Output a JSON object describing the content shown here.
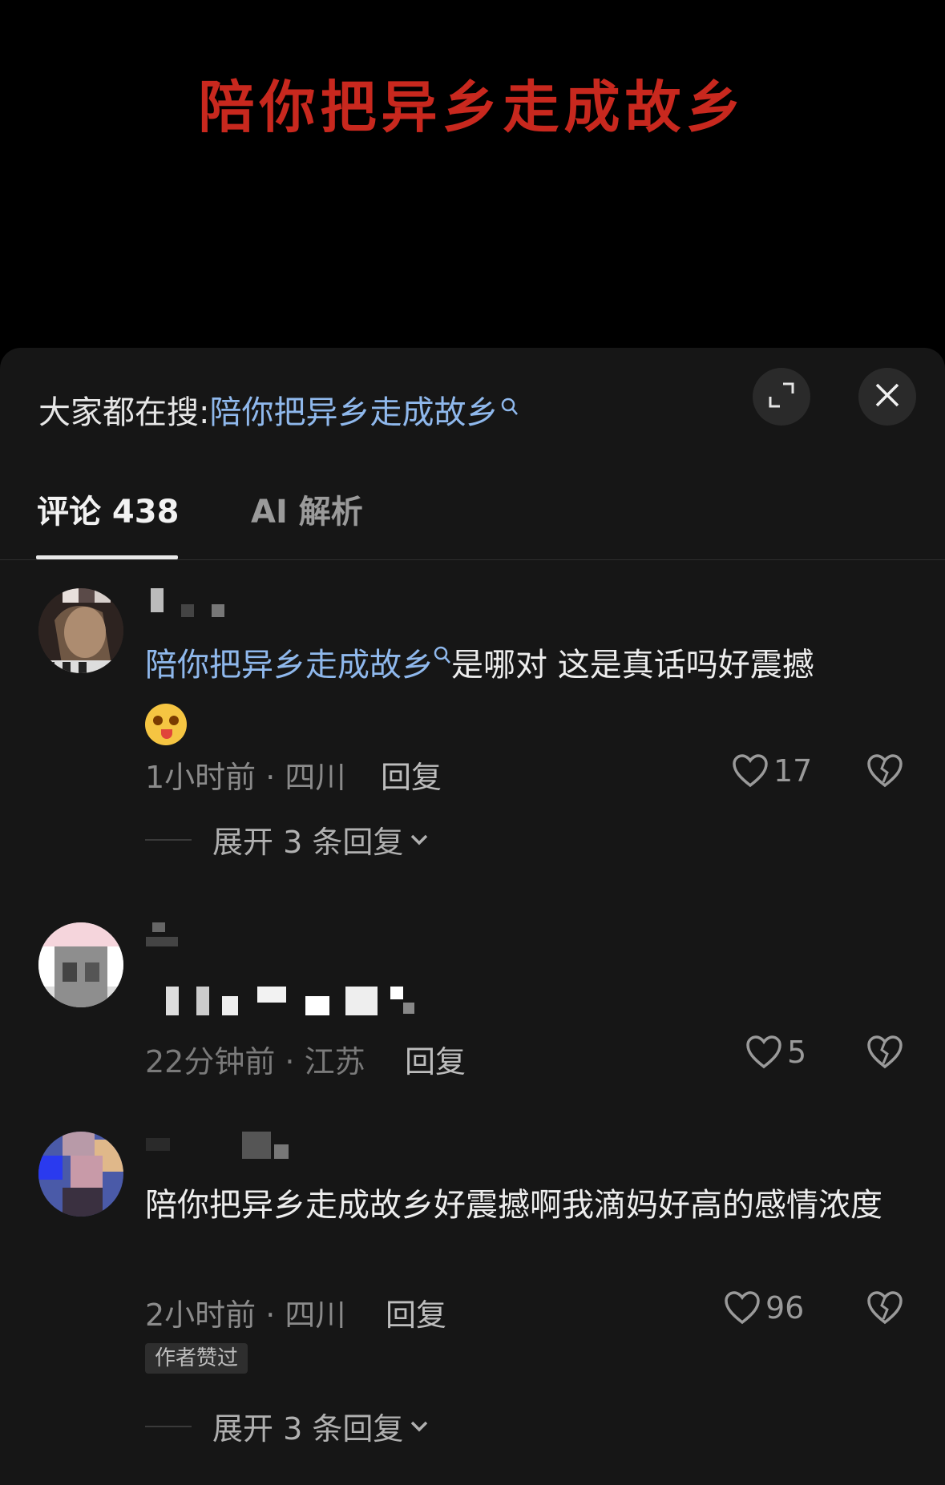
{
  "video": {
    "title": "陪你把异乡走成故乡"
  },
  "sheet": {
    "search_prefix": "大家都在搜:",
    "search_query": "陪你把异乡走成故乡",
    "tabs": [
      {
        "label": "评论 438"
      },
      {
        "label": "AI 解析"
      }
    ]
  },
  "comments": [
    {
      "text_link": "陪你把异乡走成故乡",
      "text_rest": "是哪对 这是真话吗好震撼",
      "time_location": "1小时前 · 四川",
      "reply_label": "回复",
      "likes": "17",
      "expand_label": "展开 3 条回复"
    },
    {
      "time_location": "22分钟前 · 江苏",
      "reply_label": "回复",
      "likes": "5"
    },
    {
      "text": "陪你把异乡走成故乡好震撼啊我滴妈好高的感情浓度",
      "time_location": "2小时前 · 四川",
      "reply_label": "回复",
      "likes": "96",
      "author_tag": "作者赞过",
      "expand_label": "展开 3 条回复"
    }
  ],
  "colors": {
    "accent_link": "#8fb8ec",
    "title_red": "#c8281e",
    "sheet_bg": "#161616"
  },
  "icons": [
    "search-icon",
    "expand-icon",
    "close-icon",
    "heart-icon",
    "broken-heart-icon",
    "chevron-down-icon"
  ]
}
